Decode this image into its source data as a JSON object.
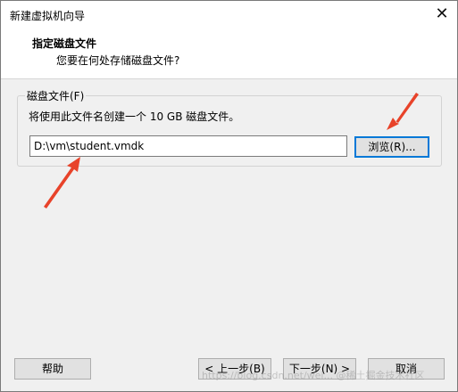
{
  "window": {
    "title": "新建虚拟机向导",
    "close_glyph": "✕"
  },
  "header": {
    "title": "指定磁盘文件",
    "subtitle": "您要在何处存储磁盘文件?"
  },
  "disk_group": {
    "legend": "磁盘文件(F)",
    "description": "将使用此文件名创建一个 10 GB 磁盘文件。",
    "path_value": "D:\\vm\\student.vmdk",
    "browse_label": "浏览(R)..."
  },
  "footer": {
    "help_label": "帮助",
    "back_label": "< 上一步(B)",
    "next_label": "下一步(N) >",
    "cancel_label": "取消"
  },
  "watermark": {
    "text": "https://blog.csdn.net/wei... @稀土掘金技术社区"
  },
  "annotations": {
    "arrow_color": "#e8432a"
  }
}
